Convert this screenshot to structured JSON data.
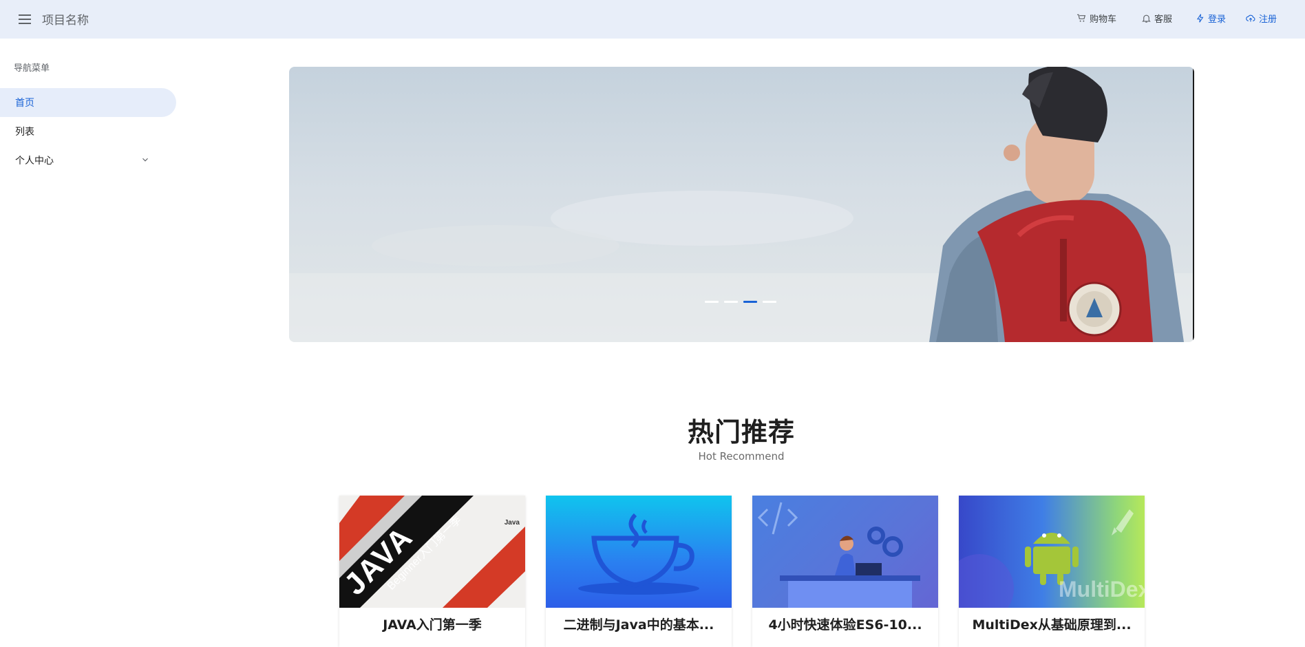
{
  "header": {
    "app_title": "项目名称",
    "actions": {
      "cart": "购物车",
      "service": "客服",
      "login": "登录",
      "register": "注册"
    },
    "colors": {
      "background": "#e8eef9",
      "accent": "#1a63d6"
    }
  },
  "sidebar": {
    "heading": "导航菜单",
    "items": [
      {
        "label": "首页",
        "active": true
      },
      {
        "label": "列表"
      },
      {
        "label": "个人中心",
        "has_submenu": true
      }
    ]
  },
  "banner": {
    "slide_count": 4,
    "active_slide": 3
  },
  "hot": {
    "title": "热门推荐",
    "subtitle": "Hot Recommend",
    "cards": [
      {
        "title": "JAVA入门第一季",
        "thumb_text": "JAVA",
        "thumb_sub": "Beginner入门第一季",
        "thumb_logo": "Java"
      },
      {
        "title": "二进制与Java中的基本..."
      },
      {
        "title": "4小时快速体验ES6-10..."
      },
      {
        "title": "MultiDex从基础原理到...",
        "thumb_text": "MultiDex"
      }
    ]
  }
}
